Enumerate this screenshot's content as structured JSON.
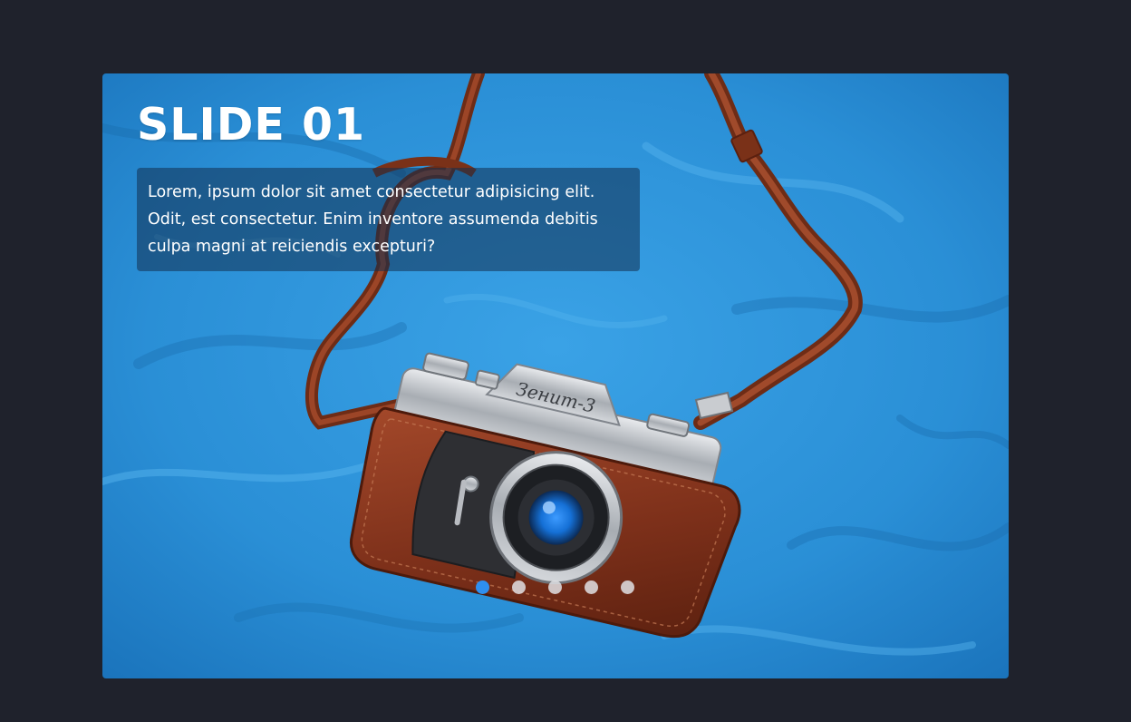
{
  "slider": {
    "title": "SLIDE 01",
    "description": "Lorem, ipsum dolor sit amet consectetur adipisicing elit. Odit, est consectetur. Enim inventore assumenda debitis culpa magni at reiciendis excepturi?",
    "camera_label": "Зенит-3",
    "dots_total": 5,
    "active_index": 0
  },
  "colors": {
    "page_background": "#1f222c",
    "fabric_blue": "#2a8fd6",
    "active_dot": "#2e8ff0",
    "inactive_dot": "#e1e1e4",
    "leather_brown": "#8a3a1e"
  }
}
